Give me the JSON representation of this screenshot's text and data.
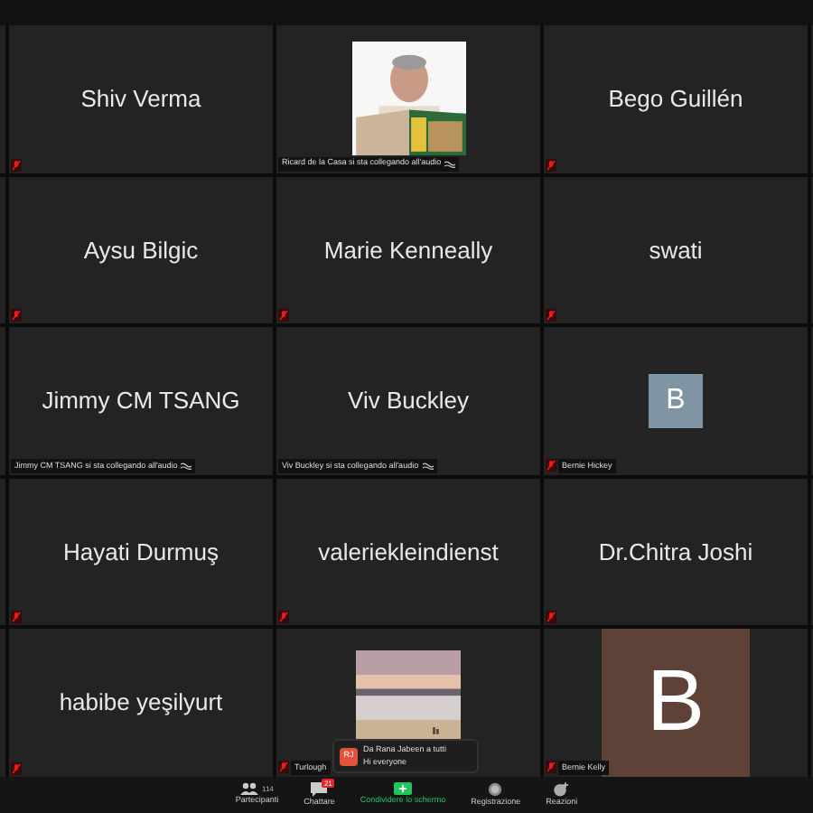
{
  "tiles": [
    {
      "kind": "name",
      "name": "Shiv Verma",
      "muted": true
    },
    {
      "kind": "portrait",
      "label": "Ricard de la Casa si sta collegando all'audio",
      "connecting": true,
      "muted": false
    },
    {
      "kind": "name",
      "name": "Bego Guillén",
      "muted": true
    },
    {
      "kind": "name",
      "name": "Aysu Bilgic",
      "muted": true
    },
    {
      "kind": "name",
      "name": "Marie Kenneally",
      "muted": true
    },
    {
      "kind": "name",
      "name": "swati",
      "muted": true
    },
    {
      "kind": "name",
      "name": "Jimmy CM TSANG",
      "label": "Jimmy CM TSANG si sta collegando all'audio",
      "connecting": true,
      "muted": false
    },
    {
      "kind": "name",
      "name": "Viv Buckley",
      "label": "Viv Buckley si sta collegando all'audio",
      "connecting": true,
      "muted": false
    },
    {
      "kind": "avatar",
      "initial": "B",
      "color": "#7f95a3",
      "label": "Bernie Hickey",
      "muted": true
    },
    {
      "kind": "name",
      "name": "Hayati Durmuş",
      "muted": true
    },
    {
      "kind": "name",
      "name": "valeriekleindienst",
      "muted": true
    },
    {
      "kind": "name",
      "name": "Dr.Chitra Joshi",
      "muted": true
    },
    {
      "kind": "name",
      "name": "habibe yeşilyurt",
      "muted": true
    },
    {
      "kind": "scenery",
      "label": "Turlough",
      "connecting": false,
      "muted": true
    },
    {
      "kind": "bigavatar",
      "initial": "B",
      "color": "#5e4237",
      "label": "Bernie Kelly",
      "muted": true
    }
  ],
  "chat_popup": {
    "initials": "RJ",
    "sender": "Da Rana Jabeen a tutti",
    "message": "Hi everyone"
  },
  "toolbar": [
    {
      "kind": "participants",
      "label": "Partecipanti",
      "count": "114"
    },
    {
      "kind": "chat",
      "label": "Chattare",
      "badge": "21"
    },
    {
      "kind": "share",
      "label": "Condividere lo schermo"
    },
    {
      "kind": "record",
      "label": "Registrazione"
    },
    {
      "kind": "reactions",
      "label": "Reazioni"
    }
  ]
}
